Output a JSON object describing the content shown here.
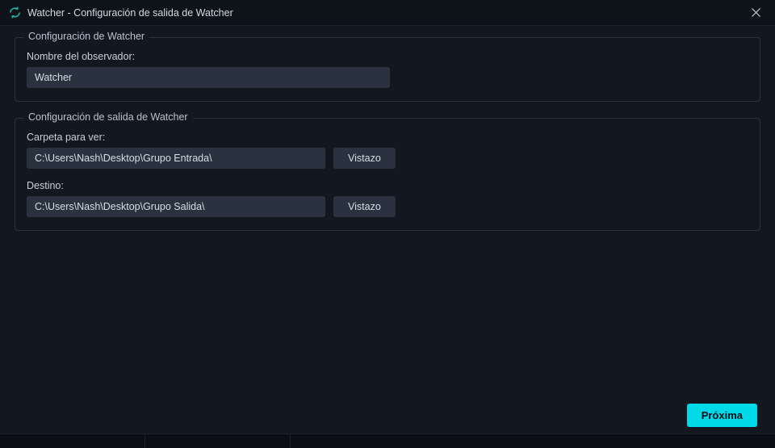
{
  "window": {
    "title": "Watcher - Configuración de salida de Watcher"
  },
  "section1": {
    "legend": "Configuración de Watcher",
    "nameLabel": "Nombre del observador:",
    "nameValue": "Watcher"
  },
  "section2": {
    "legend": "Configuración de salida de Watcher",
    "folderLabel": "Carpeta para ver:",
    "folderValue": "C:\\Users\\Nash\\Desktop\\Grupo Entrada\\",
    "folderBrowse": "Vistazo",
    "destLabel": "Destino:",
    "destValue": "C:\\Users\\Nash\\Desktop\\Grupo Salida\\",
    "destBrowse": "Vistazo"
  },
  "footer": {
    "next": "Próxima"
  }
}
